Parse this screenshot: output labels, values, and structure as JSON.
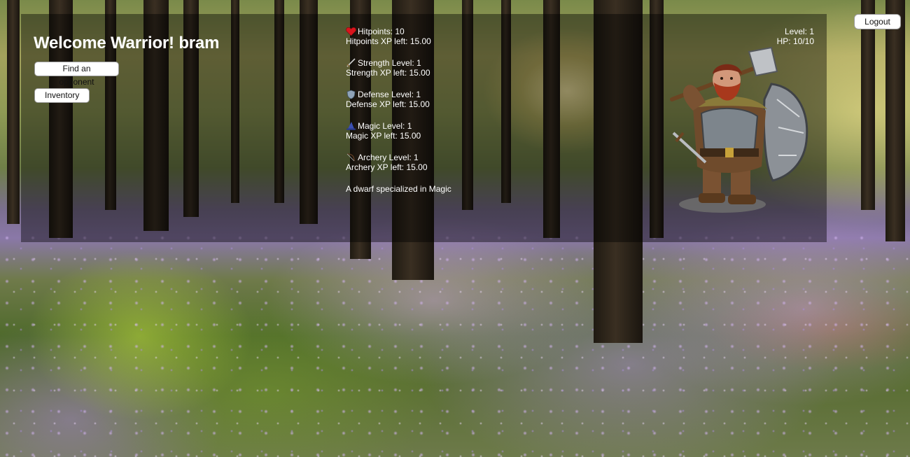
{
  "header": {
    "welcome_text": "Welcome Warrior! bram",
    "logout_label": "Logout"
  },
  "actions": {
    "find_opponent_label": "Find an opponent",
    "inventory_label": "Inventory"
  },
  "stats": {
    "hitpoints": {
      "line1": "Hitpoints: 10",
      "line2": "Hitpoints XP left: 15.00",
      "icon": "heart-icon"
    },
    "strength": {
      "line1": "Strength Level: 1",
      "line2": "Strength XP left: 15.00",
      "icon": "sword-icon"
    },
    "defense": {
      "line1": "Defense Level: 1",
      "line2": "Defense XP left: 15.00",
      "icon": "shield-icon"
    },
    "magic": {
      "line1": "Magic Level: 1",
      "line2": "Magic XP left: 15.00",
      "icon": "wizard-hat-icon"
    },
    "archery": {
      "line1": "Archery Level: 1",
      "line2": "Archery XP left: 15.00",
      "icon": "bow-icon"
    }
  },
  "description": "A dwarf specialized in Magic",
  "player_status": {
    "level": "Level: 1",
    "hp": "HP: 10/10"
  },
  "character": {
    "image": "dwarf-warrior-with-axe-and-shield"
  },
  "colors": {
    "panel_overlay": "rgba(0,0,0,0.42)",
    "text": "#ffffff",
    "button_bg": "#ffffff"
  }
}
